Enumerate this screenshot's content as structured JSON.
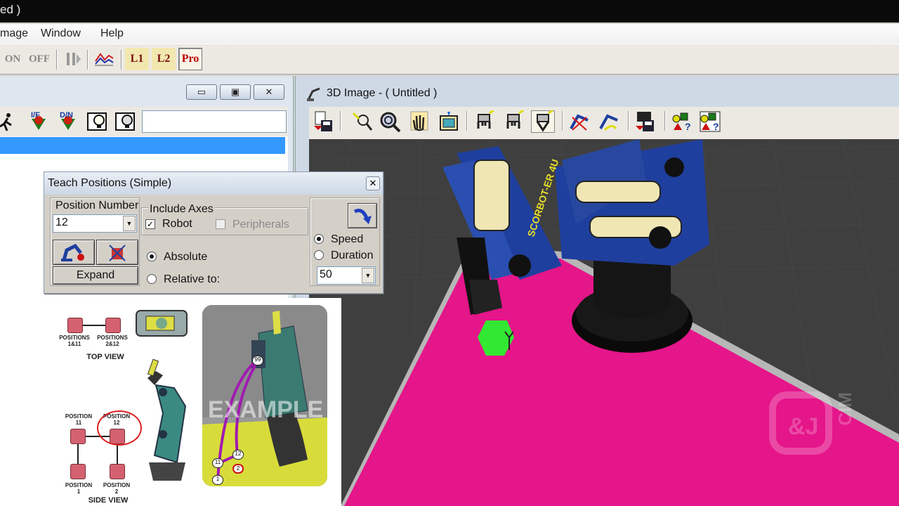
{
  "window": {
    "title_fragment": "ed )"
  },
  "menu": {
    "items": [
      "mage",
      "Window",
      "Help"
    ]
  },
  "toolbar": {
    "on_label": "ON",
    "off_label": "OFF",
    "l1_label": "L1",
    "l2_label": "L2",
    "pro_label": "Pro"
  },
  "left_window": {
    "minimize": "▭",
    "restore": "▣",
    "close": "✕",
    "program_field": ""
  },
  "image_window": {
    "title": "3D Image -  ( Untitled )"
  },
  "dialog": {
    "title": "Teach Positions (Simple)",
    "close": "✕",
    "position_number_label": "Position Number",
    "position_number_value": "12",
    "include_axes_label": "Include Axes",
    "robot_label": "Robot",
    "robot_checked": "✓",
    "peripherals_label": "Peripherals",
    "absolute_label": "Absolute",
    "relative_label": "Relative to:",
    "expand_label": "Expand",
    "speed_label": "Speed",
    "duration_label": "Duration",
    "speed_value": "50"
  },
  "diagram": {
    "positions_1_11": "POSITIONS\n1&11",
    "positions_2_12": "POSITIONS\n2&12",
    "top_view": "TOP VIEW",
    "position_11": "POSITION\n11",
    "position_12": "POSITION\n12",
    "position_1": "POSITION\n1",
    "position_2": "POSITION\n2",
    "side_view": "SIDE VIEW",
    "example": "EXAMPLE",
    "pt_99": "99",
    "pt_12": "12",
    "pt_11": "11",
    "pt_2": "2",
    "pt_1": "1"
  },
  "watermark": {
    "text": "CIM"
  },
  "colors": {
    "table": "#e5158a",
    "robot_blue": "#1f3f9e",
    "selection": "#3399ff"
  }
}
